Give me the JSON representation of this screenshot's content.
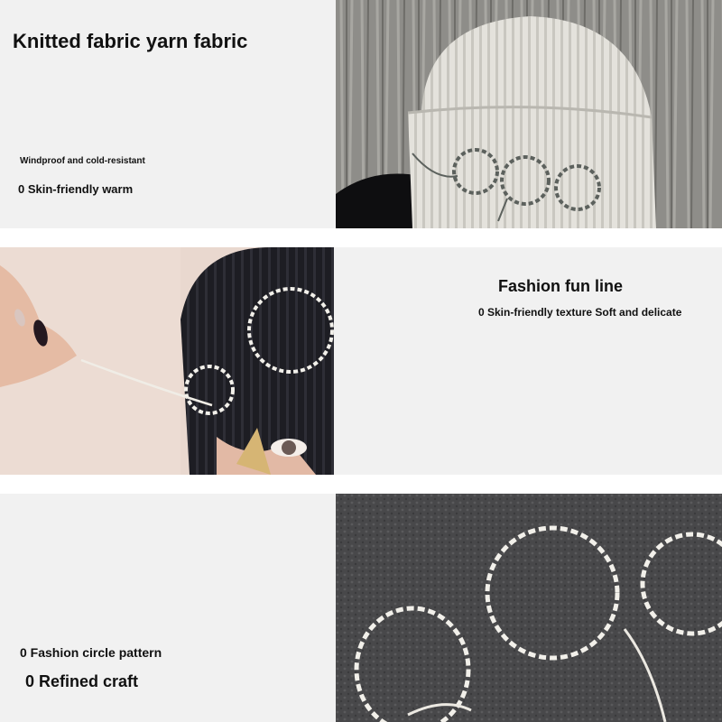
{
  "section1": {
    "title": "Knitted fabric yarn fabric",
    "feature_1": "Windproof and cold-resistant",
    "feature_2": "0 Skin-friendly warm"
  },
  "section2": {
    "title": "Fashion fun line",
    "feature_1": "0 Skin-friendly texture Soft and delicate"
  },
  "section3": {
    "feature_1": "0 Fashion circle pattern",
    "feature_2": "0 Refined craft"
  },
  "photos": [
    {
      "name": "white-beanie-photo",
      "subject": "cream ribbed knit beanie with grey stitched circles"
    },
    {
      "name": "black-beanie-photo",
      "subject": "black knit beanie with white stitched circles, hand pulling yarn"
    },
    {
      "name": "grey-beanie-photo",
      "subject": "charcoal fuzzy knit beanie close-up with white stitched circles"
    }
  ],
  "colors": {
    "panel_bg": "#f1f1f1",
    "text": "#111111",
    "cream_knit": "#e2e0da",
    "black_knit": "#1c1c22",
    "grey_knit": "#4a4a4c"
  }
}
